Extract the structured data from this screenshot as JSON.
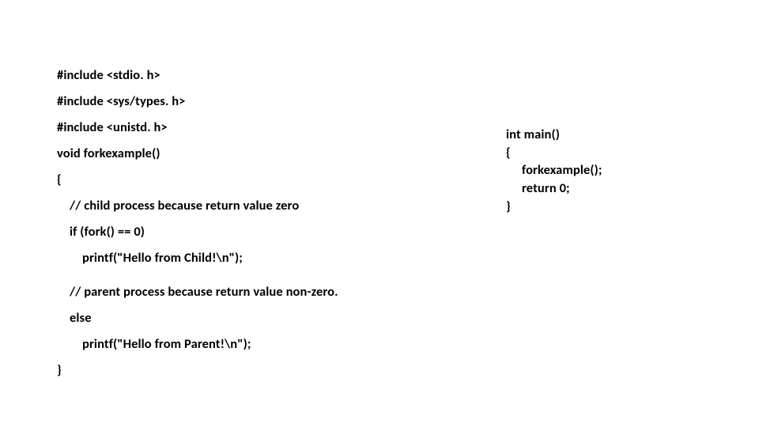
{
  "code_left": {
    "l1": "#include <stdio. h>",
    "l2": "#include <sys/types. h>",
    "l3": "#include <unistd. h>",
    "l4": "void forkexample()",
    "l5": "{",
    "l6": "// child process because return value zero",
    "l7": "if (fork() == 0)",
    "l8": "printf(\"Hello from Child!\\n\");",
    "l9": "// parent process because return value non-zero.",
    "l10": "else",
    "l11": "printf(\"Hello from Parent!\\n\");",
    "l12": "}"
  },
  "code_right": {
    "r1": "int main()",
    "r2": "{",
    "r3": "forkexample();",
    "r4": "return 0;",
    "r5": "}"
  }
}
